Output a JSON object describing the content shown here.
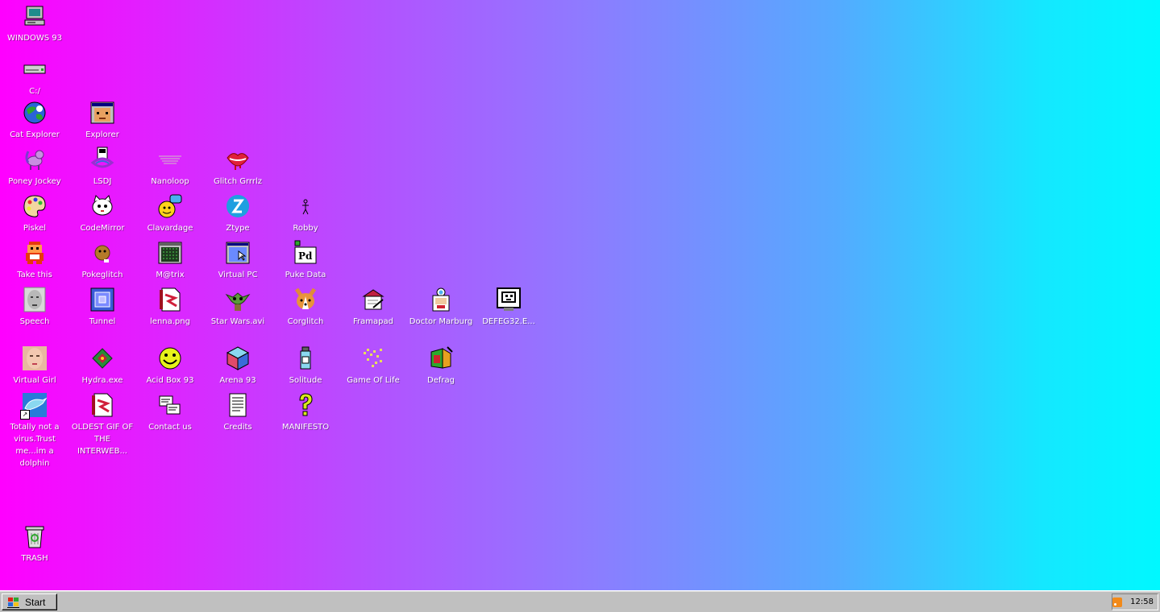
{
  "desktop": {
    "icons": [
      {
        "label": "WINDOWS 93",
        "icon": "computer-icon"
      },
      {
        "label": "C:/",
        "icon": "drive-icon"
      },
      {
        "label": "Cat Explorer",
        "icon": "globe-icon"
      },
      {
        "label": "Explorer",
        "icon": "explorer-window-icon"
      },
      {
        "label": "Poney Jockey",
        "icon": "pony-icon"
      },
      {
        "label": "LSDJ",
        "icon": "gameboy-icon"
      },
      {
        "label": "Nanoloop",
        "icon": "wave-icon"
      },
      {
        "label": "Glitch Grrrlz",
        "icon": "lips-icon"
      },
      {
        "label": "Piskel",
        "icon": "palette-icon"
      },
      {
        "label": "CodeMirror",
        "icon": "cat-code-icon"
      },
      {
        "label": "Clavardage",
        "icon": "chat-icon"
      },
      {
        "label": "Ztype",
        "icon": "ztype-icon"
      },
      {
        "label": "Robby",
        "icon": "stick-figure-icon"
      },
      {
        "label": "Take this",
        "icon": "pixel-man-icon"
      },
      {
        "label": "Pokeglitch",
        "icon": "pokeglitch-icon"
      },
      {
        "label": "M@trix",
        "icon": "matrix-icon"
      },
      {
        "label": "Virtual PC",
        "icon": "virtual-pc-icon"
      },
      {
        "label": "Puke Data",
        "icon": "pd-icon"
      },
      {
        "label": "Speech",
        "icon": "face-speech-icon"
      },
      {
        "label": "Tunnel",
        "icon": "tunnel-icon"
      },
      {
        "label": "lenna.png",
        "icon": "image-file-icon"
      },
      {
        "label": "Star Wars.avi",
        "icon": "yoda-icon"
      },
      {
        "label": "Corglitch",
        "icon": "corgi-icon"
      },
      {
        "label": "Framapad",
        "icon": "framapad-icon"
      },
      {
        "label": "Doctor Marburg",
        "icon": "doctor-icon"
      },
      {
        "label": "DEFEG32.E...",
        "icon": "defeg-monitor-icon"
      },
      {
        "label": "Virtual Girl",
        "icon": "girl-face-icon"
      },
      {
        "label": "Hydra.exe",
        "icon": "hydra-icon"
      },
      {
        "label": "Acid Box 93",
        "icon": "smiley-icon"
      },
      {
        "label": "Arena 93",
        "icon": "cube-icon"
      },
      {
        "label": "Solitude",
        "icon": "bottle-icon"
      },
      {
        "label": "Game Of Life",
        "icon": "game-of-life-icon"
      },
      {
        "label": "Defrag",
        "icon": "defrag-icon"
      },
      {
        "label": "Totally not a virus.Trust me...im a dolphin",
        "icon": "dolphin-icon"
      },
      {
        "label": "OLDEST GIF OF THE INTERWEB...",
        "icon": "gif-file-icon"
      },
      {
        "label": "Contact us",
        "icon": "contact-icon"
      },
      {
        "label": "Credits",
        "icon": "document-icon"
      },
      {
        "label": "MANIFESTO",
        "icon": "question-mark-icon"
      },
      {
        "label": "TRASH",
        "icon": "trash-icon"
      }
    ]
  },
  "taskbar": {
    "start_label": "Start",
    "clock": "12:58"
  },
  "colors": {
    "gradient_left": "#ff00ff",
    "gradient_right": "#00f8ff",
    "taskbar": "#c0c0c0"
  }
}
